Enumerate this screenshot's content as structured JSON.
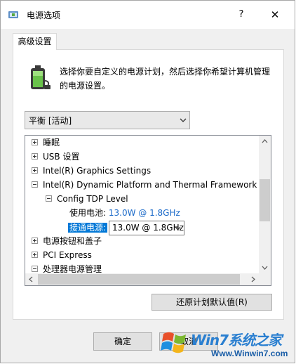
{
  "window": {
    "title": "电源选项",
    "help_label": "?",
    "close_label": "✕"
  },
  "tab": {
    "label": "高级设置"
  },
  "description": "选择你要自定义的电源计划，然后选择你希望计算机管理的电源设置。",
  "plan_select": {
    "value": "平衡 [活动]"
  },
  "tree": {
    "items": [
      {
        "label": "睡眠",
        "expander": "plus"
      },
      {
        "label": "USB 设置",
        "expander": "plus"
      },
      {
        "label": "Intel(R) Graphics Settings",
        "expander": "plus"
      },
      {
        "label": "Intel(R) Dynamic Platform and Thermal Framework Se",
        "expander": "minus"
      },
      {
        "label": "Config TDP Level",
        "expander": "minus"
      },
      {
        "label": "电源按钮和盖子",
        "expander": "plus"
      },
      {
        "label": "PCI Express",
        "expander": "plus"
      },
      {
        "label": "处理器电源管理",
        "expander": "minus"
      }
    ],
    "battery": {
      "label": "使用电池:",
      "value": "13.0W @ 1.8GHz"
    },
    "plugged": {
      "label": "接通电源:",
      "value": "13.0W @ 1.8GHz"
    }
  },
  "buttons": {
    "restore": "还原计划默认值(R)",
    "ok": "确定",
    "cancel": "取消"
  },
  "watermark": {
    "brand": "Win7系统之家",
    "url": "Www.Winwin7.com"
  },
  "colors": {
    "accent": "#0078d7",
    "link": "#1b6ac9",
    "watermark": "#2a7fd0"
  },
  "icons": [
    "power-options-icon",
    "battery-plug-icon",
    "chevron-down-icon",
    "expander-plus-icon",
    "expander-minus-icon",
    "scroll-arrow-icon",
    "windows-logo-icon"
  ]
}
